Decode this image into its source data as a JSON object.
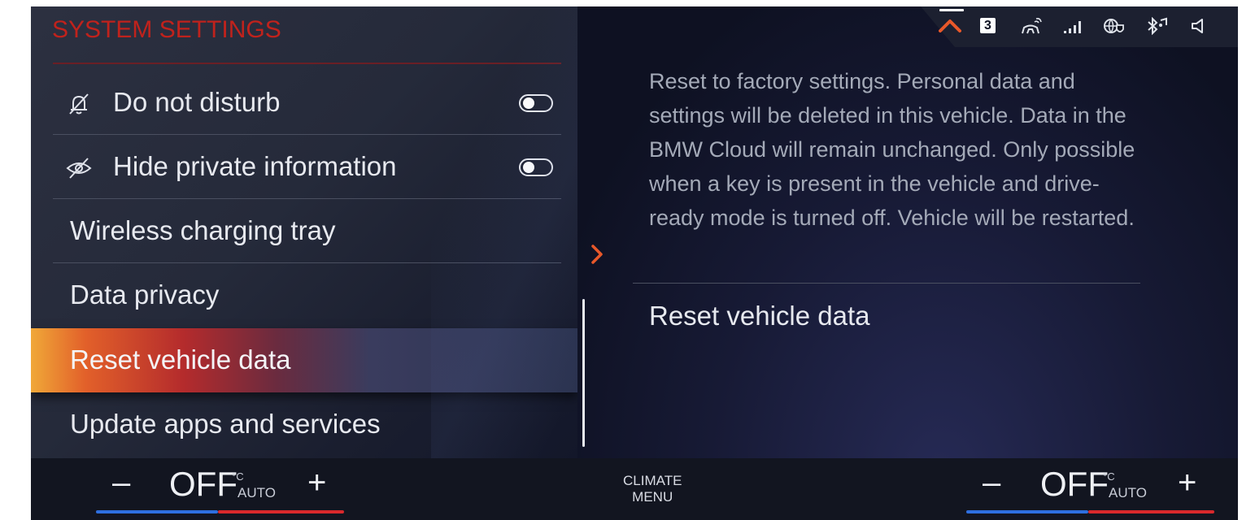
{
  "left_panel": {
    "title": "SYSTEM SETTINGS",
    "items": [
      {
        "label": "Do not disturb",
        "icon": "bell-off-icon",
        "toggle": "off"
      },
      {
        "label": "Hide private information",
        "icon": "eye-off-icon",
        "toggle": "off"
      },
      {
        "label": "Wireless charging tray"
      },
      {
        "label": "Data privacy"
      },
      {
        "label": "Reset vehicle data",
        "selected": true
      },
      {
        "label": "Update apps and services"
      }
    ]
  },
  "status_bar": {
    "notification_count": "3",
    "icons": [
      "chevron-up-icon",
      "notification-count-badge",
      "antenna-icon",
      "signal-bars-icon",
      "globe-shield-icon",
      "bluetooth-music-icon",
      "volume-icon"
    ]
  },
  "detail": {
    "description": "Reset to factory settings. Personal data and settings will be deleted in this vehicle. Data in the BMW Cloud will remain unchanged. Only possible when a key is present in the vehicle and drive-ready mode is turned off. Vehicle will be restarted.",
    "action_label": "Reset vehicle data"
  },
  "climate": {
    "left": {
      "minus": "–",
      "value": "OFF",
      "unit": "°C",
      "mode": "AUTO",
      "plus": "+"
    },
    "menu_line1": "CLIMATE",
    "menu_line2": "MENU",
    "right": {
      "minus": "–",
      "value": "OFF",
      "unit": "°C",
      "mode": "AUTO",
      "plus": "+"
    }
  },
  "colors": {
    "accent": "#c0221c",
    "highlight_start": "#f0a838",
    "temp_cold": "#2e6fe0",
    "temp_hot": "#d8282c"
  }
}
